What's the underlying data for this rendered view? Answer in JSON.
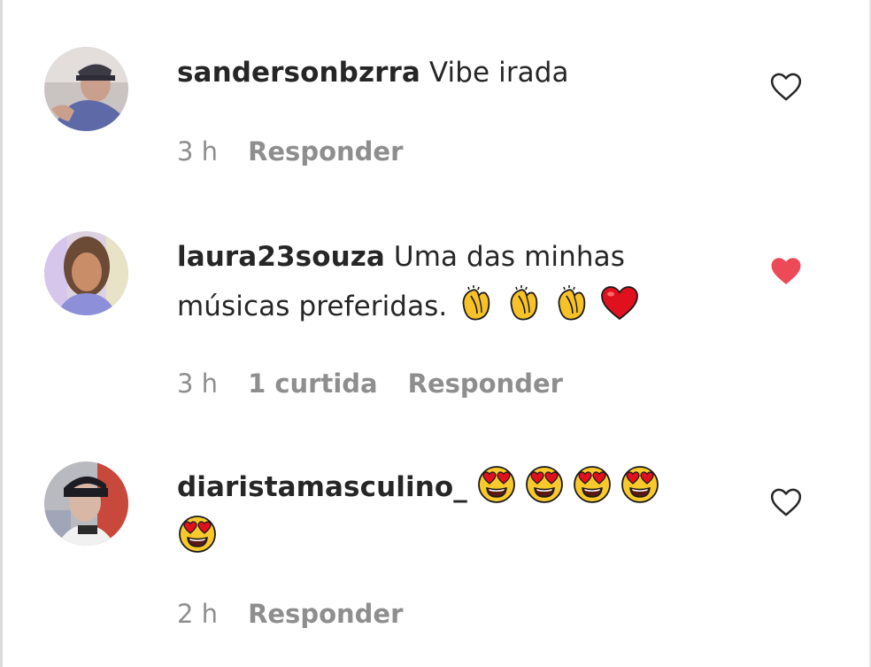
{
  "comments": [
    {
      "username": "sandersonbzrra",
      "text": "Vibe irada",
      "time": "3 h",
      "likes": "",
      "reply": "Responder",
      "liked": false,
      "like_icon": "heart-outline-icon"
    },
    {
      "username": "laura23souza",
      "text_line1": "Uma das minhas",
      "text_line2": "músicas preferidas.",
      "emojis": [
        "clapping-hands-emoji",
        "clapping-hands-emoji",
        "clapping-hands-emoji",
        "red-heart-emoji"
      ],
      "time": "3 h",
      "likes": "1 curtida",
      "reply": "Responder",
      "liked": true,
      "like_icon": "heart-filled-icon"
    },
    {
      "username": "diaristamasculino_",
      "emojis": [
        "heart-eyes-emoji",
        "heart-eyes-emoji",
        "heart-eyes-emoji",
        "heart-eyes-emoji",
        "heart-eyes-emoji"
      ],
      "time": "2 h",
      "likes": "",
      "reply": "Responder",
      "liked": false,
      "like_icon": "heart-outline-icon"
    }
  ],
  "colors": {
    "text": "#262626",
    "meta": "#8e8e8e",
    "liked_heart": "#ed4956"
  }
}
